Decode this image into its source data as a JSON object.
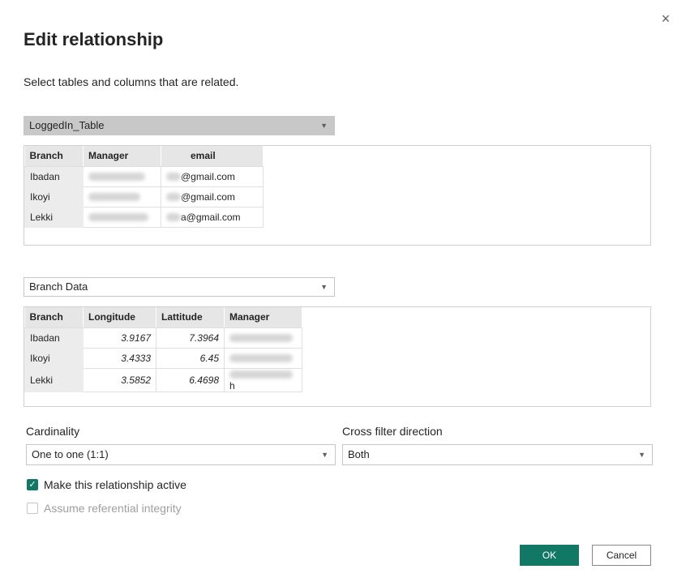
{
  "dialog": {
    "title": "Edit relationship",
    "subtitle": "Select tables and columns that are related.",
    "close_icon": "×"
  },
  "table1": {
    "selected": "LoggedIn_Table",
    "columns": [
      "Branch",
      "Manager",
      "email"
    ],
    "rows": [
      {
        "branch": "Ibadan",
        "email_suffix": "@gmail.com"
      },
      {
        "branch": "Ikoyi",
        "email_suffix": "@gmail.com"
      },
      {
        "branch": "Lekki",
        "email_suffix": "a@gmail.com"
      }
    ]
  },
  "table2": {
    "selected": "Branch Data",
    "columns": [
      "Branch",
      "Longitude",
      "Lattitude",
      "Manager"
    ],
    "rows": [
      {
        "branch": "Ibadan",
        "longitude": "3.9167",
        "lattitude": "7.3964",
        "manager_suffix": ""
      },
      {
        "branch": "Ikoyi",
        "longitude": "3.4333",
        "lattitude": "6.45",
        "manager_suffix": ""
      },
      {
        "branch": "Lekki",
        "longitude": "3.5852",
        "lattitude": "6.4698",
        "manager_suffix": "h"
      }
    ]
  },
  "cardinality": {
    "label": "Cardinality",
    "value": "One to one (1:1)"
  },
  "cross_filter": {
    "label": "Cross filter direction",
    "value": "Both"
  },
  "options": {
    "active_label": "Make this relationship active",
    "active_checked": true,
    "integrity_label": "Assume referential integrity",
    "integrity_checked": false
  },
  "buttons": {
    "ok": "OK",
    "cancel": "Cancel"
  },
  "colors": {
    "accent": "#117865",
    "disabled_text": "#a19f9d"
  }
}
